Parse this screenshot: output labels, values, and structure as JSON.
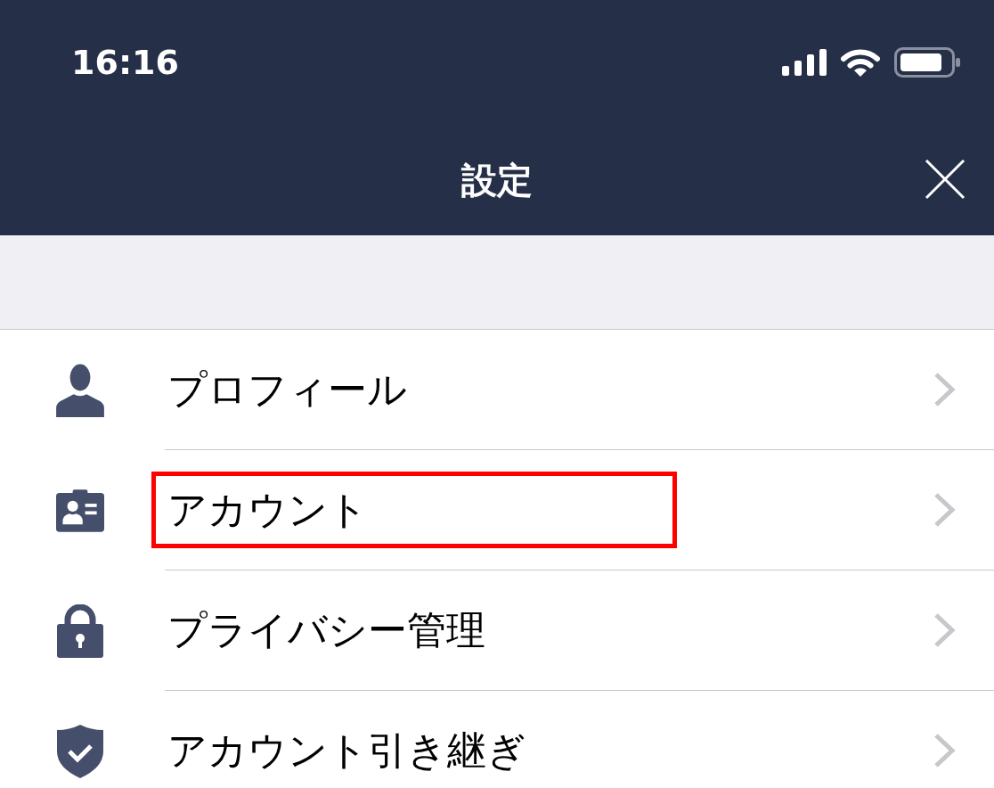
{
  "status_bar": {
    "time": "16:16"
  },
  "nav_bar": {
    "title": "設定"
  },
  "settings_list": {
    "items": [
      {
        "label": "プロフィール",
        "highlighted": false
      },
      {
        "label": "アカウント",
        "highlighted": true
      },
      {
        "label": "プライバシー管理",
        "highlighted": false
      },
      {
        "label": "アカウント引き継ぎ",
        "highlighted": false
      }
    ]
  }
}
